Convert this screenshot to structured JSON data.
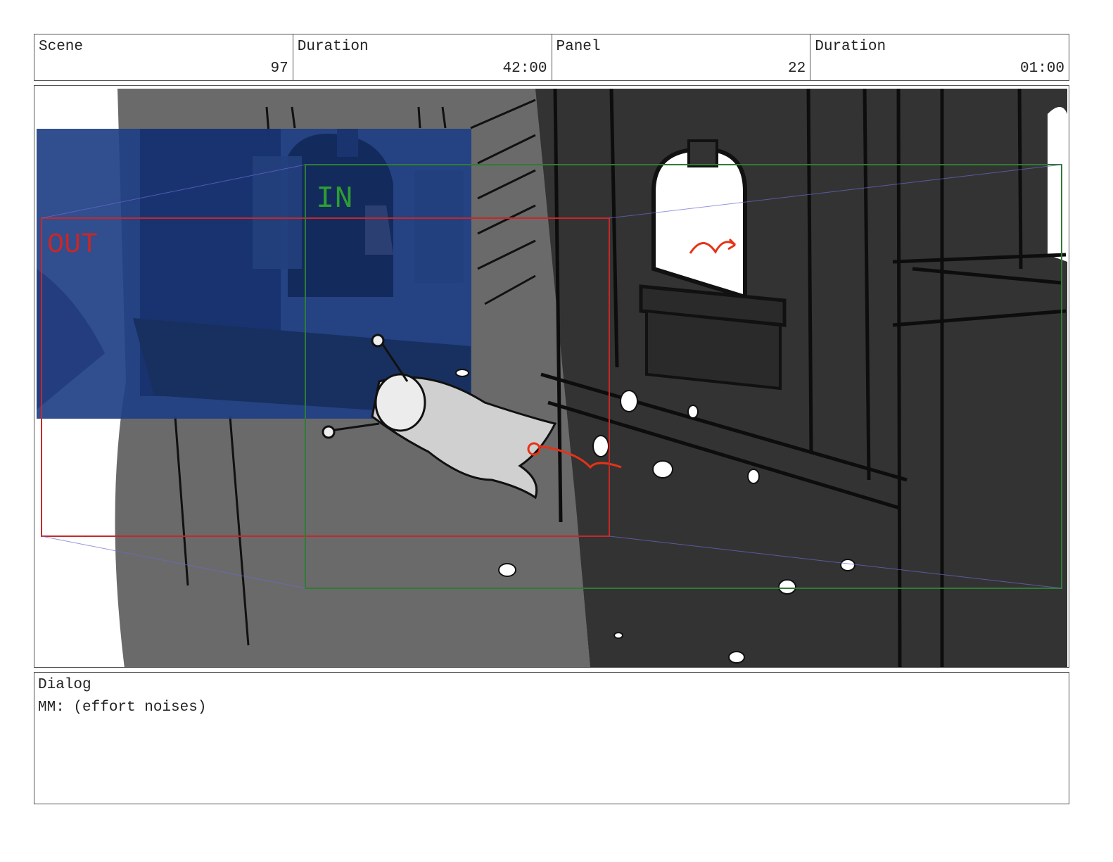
{
  "header": {
    "scene_label": "Scene",
    "scene_value": "97",
    "scene_duration_label": "Duration",
    "scene_duration_value": "42:00",
    "panel_label": "Panel",
    "panel_value": "22",
    "panel_duration_label": "Duration",
    "panel_duration_value": "01:00"
  },
  "panel": {
    "in_label": "IN",
    "out_label": "OUT",
    "colors": {
      "in_frame": "#2e7d32",
      "out_frame": "#c62828",
      "action_arrow": "#e53317",
      "bg_wall": "#6a6a6a",
      "dark_building": "#333333",
      "bg_overlay": "#1f3f86"
    }
  },
  "dialog": {
    "label": "Dialog",
    "text": "MM: (effort noises)"
  }
}
